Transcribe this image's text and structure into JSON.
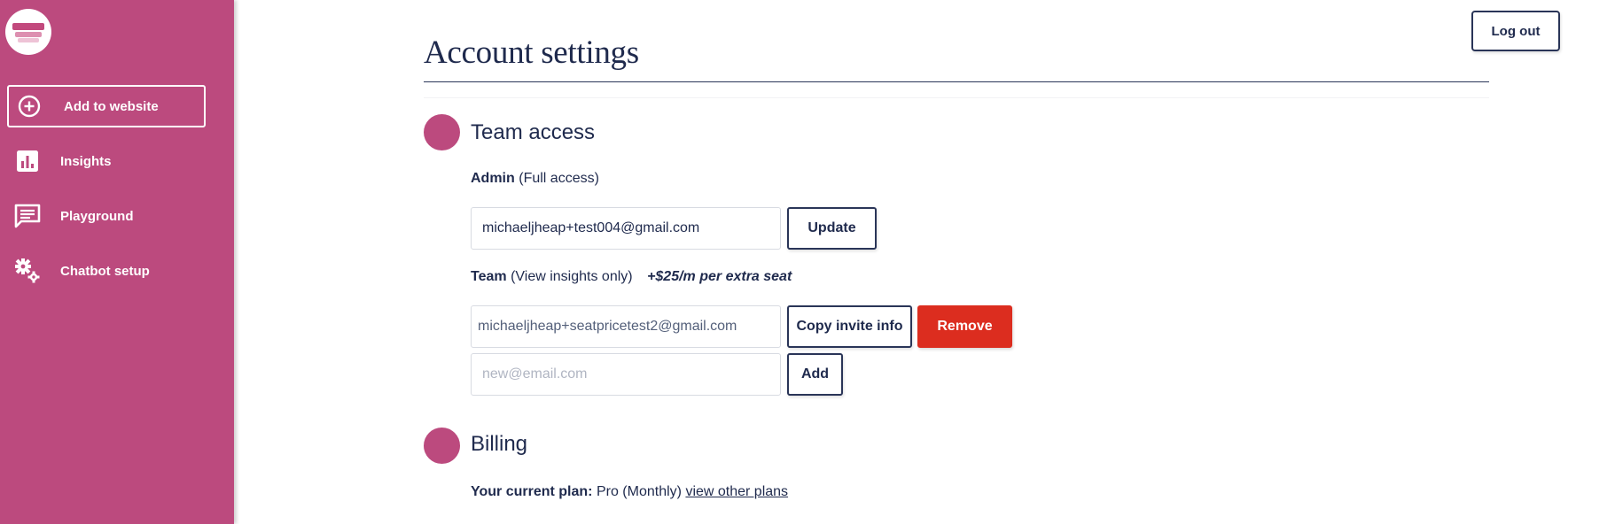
{
  "colors": {
    "brand": "#bc4a7e",
    "text": "#1f2a4d",
    "danger": "#dc2d1f"
  },
  "sidebar": {
    "items": [
      {
        "label": "Add to website",
        "icon": "plus-circle-icon"
      },
      {
        "label": "Insights",
        "icon": "bar-chart-icon"
      },
      {
        "label": "Playground",
        "icon": "chat-icon"
      },
      {
        "label": "Chatbot setup",
        "icon": "gears-icon"
      }
    ]
  },
  "header": {
    "logout_label": "Log out",
    "title": "Account settings"
  },
  "team_access": {
    "title": "Team access",
    "admin_label": "Admin",
    "admin_note": "(Full access)",
    "admin_email": "michaeljheap+test004@gmail.com",
    "update_label": "Update",
    "team_label": "Team",
    "team_note": "(View insights only)",
    "seat_price": "+$25/m per extra seat",
    "member_email": "michaeljheap+seatpricetest2@gmail.com",
    "copy_invite_label": "Copy invite info",
    "remove_label": "Remove",
    "new_placeholder": "new@email.com",
    "add_label": "Add"
  },
  "billing": {
    "title": "Billing",
    "plan_label": "Your current plan:",
    "plan_value": "Pro (Monthly)",
    "other_plans_link": "view other plans"
  }
}
